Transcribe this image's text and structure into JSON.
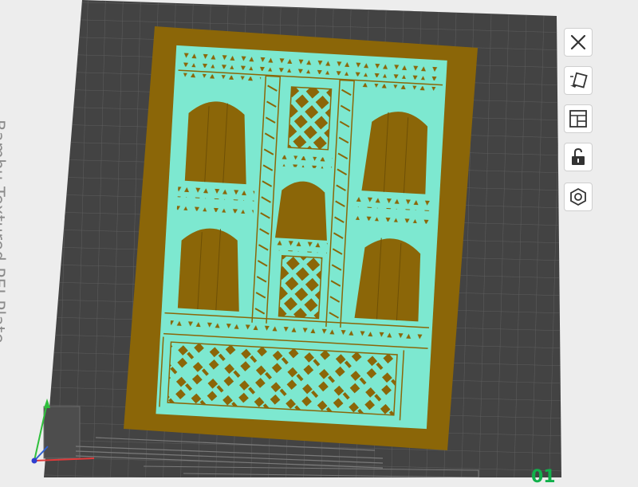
{
  "plate": {
    "label": "Bambu Textured PEI Plate",
    "number": "01"
  },
  "toolbar": {
    "buttons": [
      {
        "name": "close-icon",
        "action": "remove-plate"
      },
      {
        "name": "auto-orient-icon",
        "action": "auto-orient"
      },
      {
        "name": "arrange-icon",
        "action": "arrange"
      },
      {
        "name": "lock-icon",
        "action": "lock-plate"
      },
      {
        "name": "plate-settings-icon",
        "action": "plate-settings"
      }
    ]
  },
  "colors": {
    "background": "#ededed",
    "plate": "#434343",
    "grid": "#5e5e5e",
    "brim": "#8b6608",
    "model": "#7de8d0",
    "label": "#8c8c8c",
    "plate_number": "#11b04b"
  }
}
